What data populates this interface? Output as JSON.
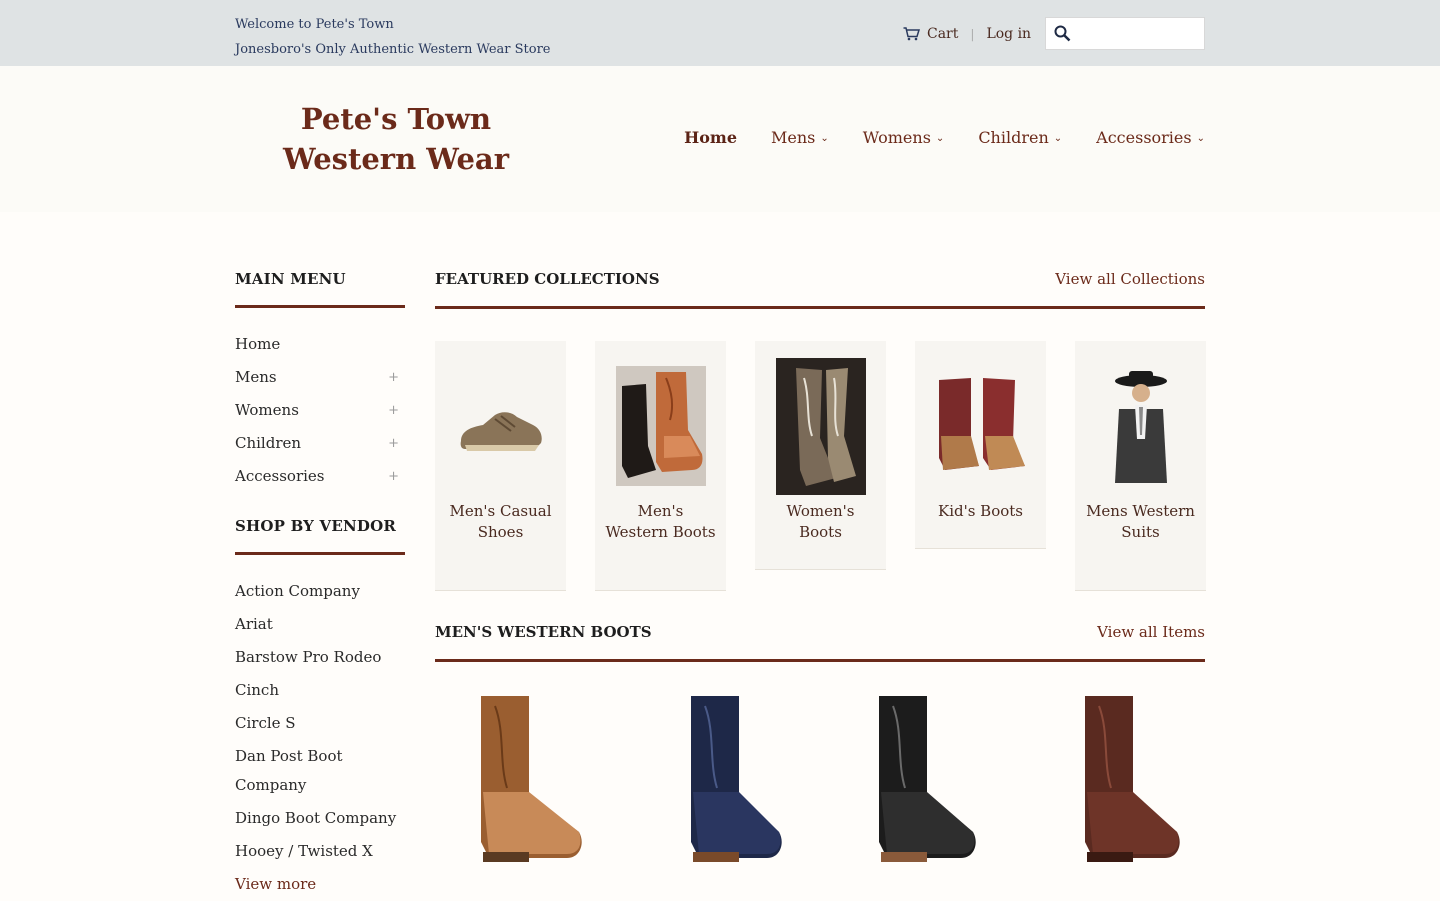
{
  "topbar": {
    "welcome_line1": "Welcome to Pete's Town",
    "welcome_line2": "Jonesboro's Only Authentic Western Wear Store",
    "cart_label": "Cart",
    "cart_icon": "cart-icon",
    "login_label": "Log in",
    "search_icon": "search-icon",
    "search_placeholder": ""
  },
  "header": {
    "logo": "Pete's Town Western Wear",
    "nav": [
      {
        "label": "Home",
        "active": true
      },
      {
        "label": "Mens"
      },
      {
        "label": "Womens"
      },
      {
        "label": "Children"
      },
      {
        "label": "Accessories"
      }
    ]
  },
  "sidebar": {
    "main_menu_title": "MAIN MENU",
    "main_menu": [
      "Home",
      "Mens",
      "Womens",
      "Children",
      "Accessories"
    ],
    "vendor_title": "SHOP BY VENDOR",
    "vendors": [
      "Action Company",
      "Ariat",
      "Barstow Pro Rodeo",
      "Cinch",
      "Circle S",
      "Dan Post Boot Company",
      "Dingo Boot Company",
      "Hooey / Twisted X"
    ],
    "view_more": "View more"
  },
  "featured": {
    "title": "FEATURED COLLECTIONS",
    "view_all": "View all Collections",
    "items": [
      "Men's Casual Shoes",
      "Men's Western Boots",
      "Women's Boots",
      "Kid's Boots",
      "Mens Western Suits"
    ]
  },
  "mens_boots": {
    "title": "MEN'S WESTERN BOOTS",
    "view_all": "View all Items"
  },
  "colors": {
    "accent": "#6b2a1a",
    "topbar_bg": "#dfe3e4",
    "welcome_text": "#2a3a5e"
  }
}
